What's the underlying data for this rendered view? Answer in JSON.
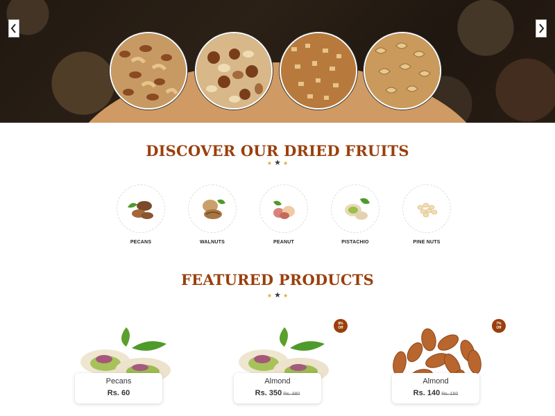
{
  "hero": {
    "prev_icon": "chevron-left-icon",
    "next_icon": "chevron-right-icon",
    "bowls": [
      "mixed-nuts",
      "assorted-nuts",
      "chopped-nuts",
      "walnut-halves"
    ],
    "arc_color": "#cf9a63"
  },
  "discover": {
    "title": "DISCOVER OUR DRIED FRUITS",
    "categories": [
      {
        "label": "PECANS",
        "icon": "pecan-icon"
      },
      {
        "label": "WALNUTS",
        "icon": "walnut-icon"
      },
      {
        "label": "PEANUT",
        "icon": "peanut-icon"
      },
      {
        "label": "PISTACHIO",
        "icon": "pistachio-icon"
      },
      {
        "label": "PINE NUTS",
        "icon": "pine-nut-icon"
      }
    ]
  },
  "featured": {
    "title": "FEATURED PRODUCTS",
    "products": [
      {
        "name": "Pecans",
        "price": "Rs. 60",
        "old_price": "",
        "discount": "",
        "image": "pistachio-image"
      },
      {
        "name": "Almond",
        "price": "Rs. 350",
        "old_price": "Rs. 380",
        "discount_line1": "8%",
        "discount_line2": "Off",
        "image": "pistachio-image"
      },
      {
        "name": "Almond",
        "price": "Rs. 140",
        "old_price": "Rs. 150",
        "discount_line1": "7%",
        "discount_line2": "Off",
        "image": "almond-image"
      }
    ]
  },
  "colors": {
    "brand": "#9a3f0c",
    "star_gold": "#e1a92a",
    "star_dark": "#3a3a3a"
  }
}
